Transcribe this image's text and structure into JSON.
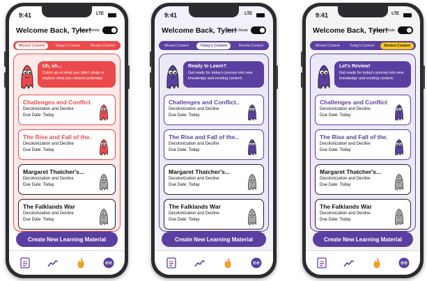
{
  "colors": {
    "red": "#ea4a4c",
    "red_light": "#fde9e8",
    "purple": "#5a3fa0",
    "purple_light": "#ece8f7",
    "yellow": "#f6c61d",
    "gray": "#a5a5a5"
  },
  "phones": [
    {
      "status_time": "9:41",
      "status_signal": "LTE",
      "welcome": "Welcome Back, Tyler!",
      "focus_mode": "Focus Mode",
      "tabs": [
        "Missed Content",
        "Today's Content",
        "Review Content"
      ],
      "active_tab": 0,
      "bubble_title": "Uh, oh...",
      "bubble_text": "Catch up on what you didn't study or explore what you missed yesterday",
      "cards": [
        {
          "title": "Challenges and Conflict...",
          "subtitle": "Decolonization and Decline",
          "due": "Due Date: Today",
          "style": "red"
        },
        {
          "title": "The Rise and Fall of the...",
          "subtitle": "Decolonization and Decline",
          "due": "Due Date: Today",
          "style": "red"
        },
        {
          "title": "Margaret Thatcher's...",
          "subtitle": "Decolonization and Decline",
          "due": "Due Date: Today",
          "style": "gray"
        },
        {
          "title": "The Falklands War",
          "subtitle": "Decolonization and Decline",
          "due": "Due Date: Today",
          "style": "gray"
        }
      ],
      "create_label": "Create New Learning Material"
    },
    {
      "status_time": "9:41",
      "status_signal": "LTE",
      "welcome": "Welcome Back, Tyler!",
      "focus_mode": "Focus Mode",
      "tabs": [
        "Missed Content",
        "Today's Content",
        "Review Content"
      ],
      "active_tab": 1,
      "bubble_title": "Ready to Learn?",
      "bubble_text": "Get ready for today's journey into new knowledge and exciting content.",
      "cards": [
        {
          "title": "Challenges and Conflict...",
          "subtitle": "Decolonization and Decline",
          "due": "Due Date: Today",
          "style": "purple"
        },
        {
          "title": "The Rise and Fall of the...",
          "subtitle": "Decolonization and Decline",
          "due": "Due Date: Today",
          "style": "purple"
        },
        {
          "title": "Margaret Thatcher's...",
          "subtitle": "Decolonization and Decline",
          "due": "Due Date: Today",
          "style": "gray"
        },
        {
          "title": "The Falklands War",
          "subtitle": "Decolonization and Decline",
          "due": "Due Date: Today",
          "style": "gray"
        }
      ],
      "create_label": "Create New Learning Material"
    },
    {
      "status_time": "9:41",
      "status_signal": "LTE",
      "welcome": "Welcome Back, Tyler!",
      "focus_mode": "Focus Mode",
      "tabs": [
        "Missed Content",
        "Today's Content",
        "Review Content"
      ],
      "active_tab": 2,
      "bubble_title": "Let's Review!",
      "bubble_text": "Get ready for today's journey into new knowledge and exciting content.",
      "cards": [
        {
          "title": "Challenges and Conflict...",
          "subtitle": "Decolonization and Decline",
          "due": "Due Date: Today",
          "style": "purple"
        },
        {
          "title": "The Rise and Fall of the...",
          "subtitle": "Decolonization and Decline",
          "due": "Due Date: Today",
          "style": "purple"
        },
        {
          "title": "Margaret Thatcher's...",
          "subtitle": "Decolonization and Decline",
          "due": "Due Date: Today",
          "style": "gray"
        },
        {
          "title": "The Falklands War",
          "subtitle": "Decolonization and Decline",
          "due": "Due Date: Today",
          "style": "gray"
        }
      ],
      "create_label": "Create New Learning Material"
    }
  ],
  "nav_icons": [
    "document-icon",
    "chart-icon",
    "flame-icon",
    "profile-icon"
  ]
}
